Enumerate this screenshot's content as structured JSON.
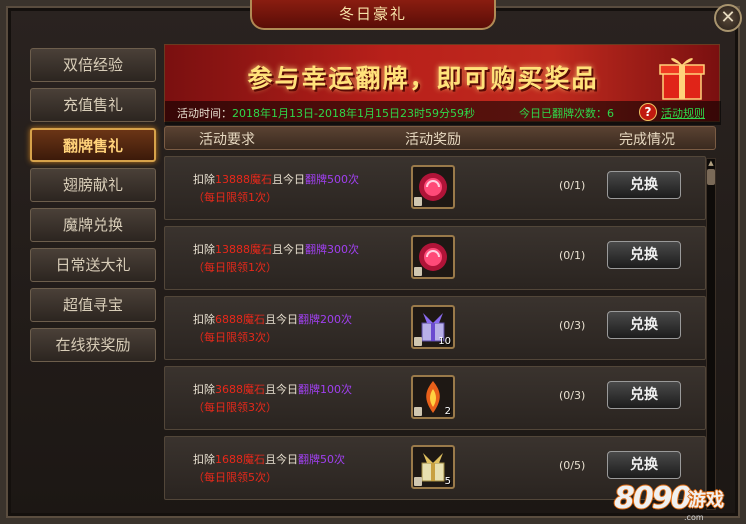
{
  "window": {
    "title": "冬日豪礼",
    "close_symbol": "✕"
  },
  "sidebar": {
    "items": [
      {
        "label": "双倍经验"
      },
      {
        "label": "充值售礼"
      },
      {
        "label": "翻牌售礼"
      },
      {
        "label": "翅膀献礼"
      },
      {
        "label": "魔牌兑换"
      },
      {
        "label": "日常送大礼"
      },
      {
        "label": "超值寻宝"
      },
      {
        "label": "在线获奖励"
      }
    ],
    "active_index": 2
  },
  "banner": {
    "headline": "参与幸运翻牌，即可购买奖品",
    "time_label": "活动时间：",
    "time_value": "2018年1月13日-2018年1月15日23时59分59秒",
    "flip_count_label": "今日已翻牌次数：6",
    "rules_link": "活动规则",
    "help_symbol": "?"
  },
  "table": {
    "headers": {
      "requirement": "活动要求",
      "reward": "活动奖励",
      "status": "完成情况"
    },
    "rows": [
      {
        "deduct": "扣除",
        "cost": "13888魔石",
        "mid": "且今日",
        "flip": "翻牌500次",
        "limit": "（每日限领1次）",
        "item": "red-orb",
        "qty": "",
        "progress": "(0/1)",
        "button": "兑换"
      },
      {
        "deduct": "扣除",
        "cost": "13888魔石",
        "mid": "且今日",
        "flip": "翻牌300次",
        "limit": "（每日限领1次）",
        "item": "red-orb",
        "qty": "",
        "progress": "(0/1)",
        "button": "兑换"
      },
      {
        "deduct": "扣除",
        "cost": "6888魔石",
        "mid": "且今日",
        "flip": "翻牌200次",
        "limit": "（每日限领3次）",
        "item": "purple-giftbox",
        "qty": "10",
        "progress": "(0/3)",
        "button": "兑换"
      },
      {
        "deduct": "扣除",
        "cost": "3688魔石",
        "mid": "且今日",
        "flip": "翻牌100次",
        "limit": "（每日限领3次）",
        "item": "flame-crystal",
        "qty": "2",
        "progress": "(0/3)",
        "button": "兑换"
      },
      {
        "deduct": "扣除",
        "cost": "1688魔石",
        "mid": "且今日",
        "flip": "翻牌50次",
        "limit": "（每日限领5次）",
        "item": "gold-giftbox",
        "qty": "5",
        "progress": "(0/5)",
        "button": "兑换"
      }
    ]
  },
  "watermark": {
    "number": "8090",
    "brand": "游戏",
    "url": ".com"
  },
  "colors": {
    "accent_red": "#e8281a",
    "accent_green": "#2fd84a",
    "accent_purple": "#a040f0",
    "gold": "#ffd27a"
  }
}
